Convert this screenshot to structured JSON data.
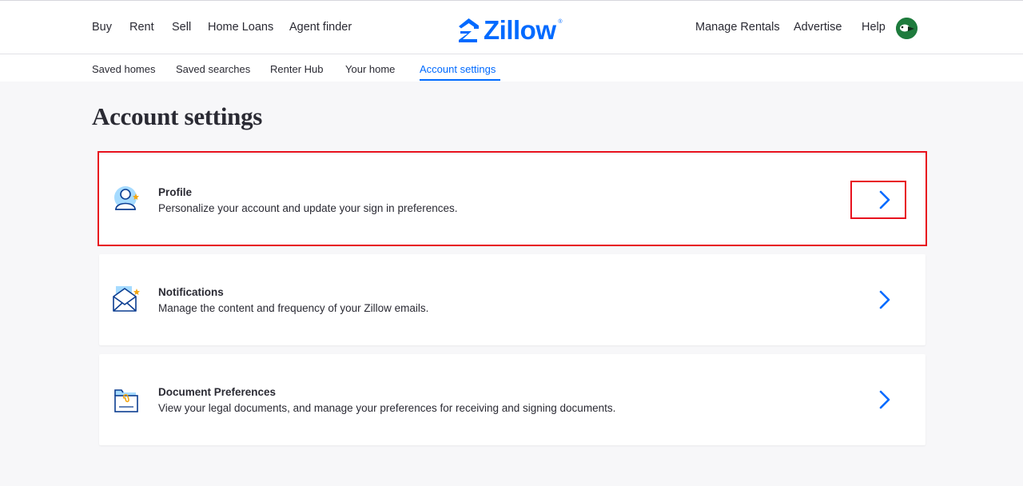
{
  "topnav": {
    "left_links": [
      "Buy",
      "Rent",
      "Sell",
      "Home Loans",
      "Agent finder"
    ],
    "logo_text": "Zillow",
    "logo_mark": "®",
    "right_links": [
      "Manage Rentals",
      "Advertise",
      "Help"
    ],
    "avatar_icon": "user-avatar-icon"
  },
  "subnav": {
    "tabs": [
      "Saved homes",
      "Saved searches",
      "Renter Hub",
      "Your home",
      "Account settings"
    ],
    "active_tab": "Account settings"
  },
  "page": {
    "title": "Account settings"
  },
  "cards": [
    {
      "title": "Profile",
      "description": "Personalize your account and update your sign in preferences.",
      "icon": "profile-icon"
    },
    {
      "title": "Notifications",
      "description": "Manage the content and frequency of your Zillow emails.",
      "icon": "envelope-icon"
    },
    {
      "title": "Document Preferences",
      "description": "View your legal documents, and manage your preferences for receiving and signing documents.",
      "icon": "document-icon"
    }
  ],
  "colors": {
    "brand": "#006aff",
    "highlight": "#e8121e",
    "text": "#2a2a33",
    "background": "#f7f7f9"
  }
}
